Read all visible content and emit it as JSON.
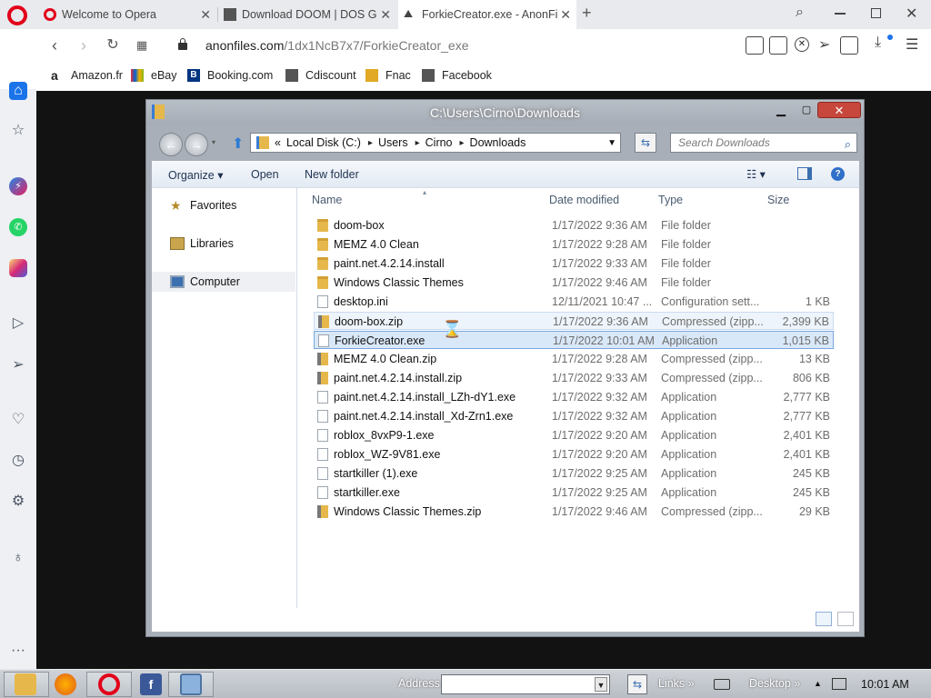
{
  "browser": {
    "tabs": [
      {
        "title": "Welcome to Opera"
      },
      {
        "title": "Download DOOM | DOS G"
      },
      {
        "title": "ForkieCreator.exe - AnonFi"
      }
    ],
    "url": {
      "domain": "anonfiles.com",
      "path": "/1dx1NcB7x7/ForkieCreator_exe"
    },
    "bookmarks": [
      "Amazon.fr",
      "eBay",
      "Booking.com",
      "Cdiscount",
      "Fnac",
      "Facebook"
    ]
  },
  "explorer": {
    "title": "C:\\Users\\Cirno\\Downloads",
    "breadcrumb": [
      "«",
      "Local Disk (C:)",
      "Users",
      "Cirno",
      "Downloads"
    ],
    "search_placeholder": "Search Downloads",
    "commands": {
      "organize": "Organize ▾",
      "open": "Open",
      "new_folder": "New folder"
    },
    "nav": {
      "favorites": "Favorites",
      "libraries": "Libraries",
      "computer": "Computer"
    },
    "columns": {
      "name": "Name",
      "date": "Date modified",
      "type": "Type",
      "size": "Size"
    },
    "files": [
      {
        "name": "doom-box",
        "date": "1/17/2022 9:36 AM",
        "type": "File folder",
        "size": "",
        "kind": "folder"
      },
      {
        "name": "MEMZ 4.0 Clean",
        "date": "1/17/2022 9:28 AM",
        "type": "File folder",
        "size": "",
        "kind": "folder"
      },
      {
        "name": "paint.net.4.2.14.install",
        "date": "1/17/2022 9:33 AM",
        "type": "File folder",
        "size": "",
        "kind": "folder"
      },
      {
        "name": "Windows Classic Themes",
        "date": "1/17/2022 9:46 AM",
        "type": "File folder",
        "size": "",
        "kind": "folder"
      },
      {
        "name": "desktop.ini",
        "date": "12/11/2021 10:47 ...",
        "type": "Configuration sett...",
        "size": "1 KB",
        "kind": "file"
      },
      {
        "name": "doom-box.zip",
        "date": "1/17/2022 9:36 AM",
        "type": "Compressed (zipp...",
        "size": "2,399 KB",
        "kind": "zip"
      },
      {
        "name": "ForkieCreator.exe",
        "date": "1/17/2022 10:01 AM",
        "type": "Application",
        "size": "1,015 KB",
        "kind": "file"
      },
      {
        "name": "MEMZ 4.0 Clean.zip",
        "date": "1/17/2022 9:28 AM",
        "type": "Compressed (zipp...",
        "size": "13 KB",
        "kind": "zip"
      },
      {
        "name": "paint.net.4.2.14.install.zip",
        "date": "1/17/2022 9:33 AM",
        "type": "Compressed (zipp...",
        "size": "806 KB",
        "kind": "zip"
      },
      {
        "name": "paint.net.4.2.14.install_LZh-dY1.exe",
        "date": "1/17/2022 9:32 AM",
        "type": "Application",
        "size": "2,777 KB",
        "kind": "file"
      },
      {
        "name": "paint.net.4.2.14.install_Xd-Zrn1.exe",
        "date": "1/17/2022 9:32 AM",
        "type": "Application",
        "size": "2,777 KB",
        "kind": "file"
      },
      {
        "name": "roblox_8vxP9-1.exe",
        "date": "1/17/2022 9:20 AM",
        "type": "Application",
        "size": "2,401 KB",
        "kind": "file"
      },
      {
        "name": "roblox_WZ-9V81.exe",
        "date": "1/17/2022 9:20 AM",
        "type": "Application",
        "size": "2,401 KB",
        "kind": "file"
      },
      {
        "name": "startkiller (1).exe",
        "date": "1/17/2022 9:25 AM",
        "type": "Application",
        "size": "245 KB",
        "kind": "file"
      },
      {
        "name": "startkiller.exe",
        "date": "1/17/2022 9:25 AM",
        "type": "Application",
        "size": "245 KB",
        "kind": "file"
      },
      {
        "name": "Windows Classic Themes.zip",
        "date": "1/17/2022 9:46 AM",
        "type": "Compressed (zipp...",
        "size": "29 KB",
        "kind": "zip"
      }
    ]
  },
  "taskbar": {
    "address_label": "Address",
    "links_label": "Links",
    "desktop_label": "Desktop",
    "clock": "10:01 AM"
  },
  "colors": {
    "opera_red": "#e2001a",
    "selection": "#d9e8f8",
    "desktop_bg": "#121212"
  }
}
